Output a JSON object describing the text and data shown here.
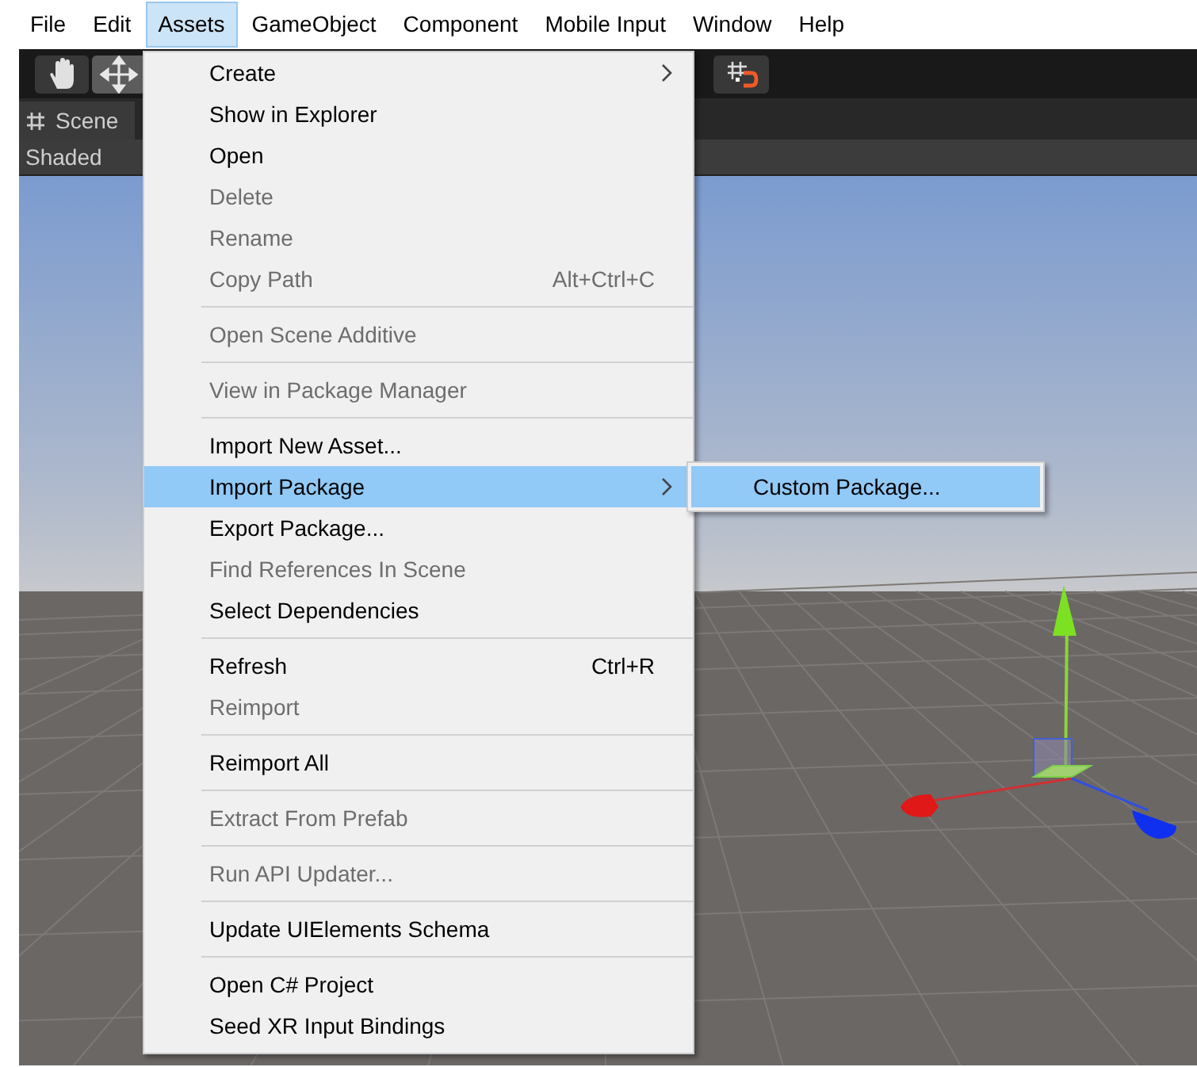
{
  "menu_bar": [
    {
      "label": "File",
      "selected": false
    },
    {
      "label": "Edit",
      "selected": false
    },
    {
      "label": "Assets",
      "selected": true
    },
    {
      "label": "GameObject",
      "selected": false
    },
    {
      "label": "Component",
      "selected": false
    },
    {
      "label": "Mobile Input",
      "selected": false
    },
    {
      "label": "Window",
      "selected": false
    },
    {
      "label": "Help",
      "selected": false
    }
  ],
  "toolbar": {
    "tools": [
      {
        "kind": "hand",
        "selected": false
      },
      {
        "kind": "move",
        "selected": true
      }
    ]
  },
  "scene_tab": {
    "title": "Scene"
  },
  "draw_mode": "Shaded",
  "assets_menu": {
    "items": [
      {
        "kind": "item",
        "label": "Create",
        "submenu": true,
        "disabled": false,
        "selected": false
      },
      {
        "kind": "item",
        "label": "Show in Explorer",
        "disabled": false,
        "selected": false
      },
      {
        "kind": "item",
        "label": "Open",
        "disabled": false,
        "selected": false
      },
      {
        "kind": "item",
        "label": "Delete",
        "disabled": true,
        "selected": false
      },
      {
        "kind": "item",
        "label": "Rename",
        "disabled": true,
        "selected": false
      },
      {
        "kind": "item",
        "label": "Copy Path",
        "shortcut": "Alt+Ctrl+C",
        "disabled": true,
        "selected": false
      },
      {
        "kind": "separator"
      },
      {
        "kind": "item",
        "label": "Open Scene Additive",
        "disabled": true,
        "selected": false
      },
      {
        "kind": "separator"
      },
      {
        "kind": "item",
        "label": "View in Package Manager",
        "disabled": true,
        "selected": false
      },
      {
        "kind": "separator"
      },
      {
        "kind": "item",
        "label": "Import New Asset...",
        "disabled": false,
        "selected": false
      },
      {
        "kind": "item",
        "label": "Import Package",
        "submenu": true,
        "disabled": false,
        "selected": true
      },
      {
        "kind": "item",
        "label": "Export Package...",
        "disabled": false,
        "selected": false
      },
      {
        "kind": "item",
        "label": "Find References In Scene",
        "disabled": true,
        "selected": false
      },
      {
        "kind": "item",
        "label": "Select Dependencies",
        "disabled": false,
        "selected": false
      },
      {
        "kind": "separator"
      },
      {
        "kind": "item",
        "label": "Refresh",
        "shortcut": "Ctrl+R",
        "disabled": false,
        "selected": false
      },
      {
        "kind": "item",
        "label": "Reimport",
        "disabled": true,
        "selected": false
      },
      {
        "kind": "separator"
      },
      {
        "kind": "item",
        "label": "Reimport All",
        "disabled": false,
        "selected": false
      },
      {
        "kind": "separator"
      },
      {
        "kind": "item",
        "label": "Extract From Prefab",
        "disabled": true,
        "selected": false
      },
      {
        "kind": "separator"
      },
      {
        "kind": "item",
        "label": "Run API Updater...",
        "disabled": true,
        "selected": false
      },
      {
        "kind": "separator"
      },
      {
        "kind": "item",
        "label": "Update UIElements Schema",
        "disabled": false,
        "selected": false
      },
      {
        "kind": "separator"
      },
      {
        "kind": "item",
        "label": "Open C# Project",
        "disabled": false,
        "selected": false
      },
      {
        "kind": "item",
        "label": "Seed XR Input Bindings",
        "disabled": false,
        "selected": false
      }
    ]
  },
  "import_package_submenu": {
    "items": [
      {
        "label": "Custom Package...",
        "selected": true
      }
    ]
  }
}
